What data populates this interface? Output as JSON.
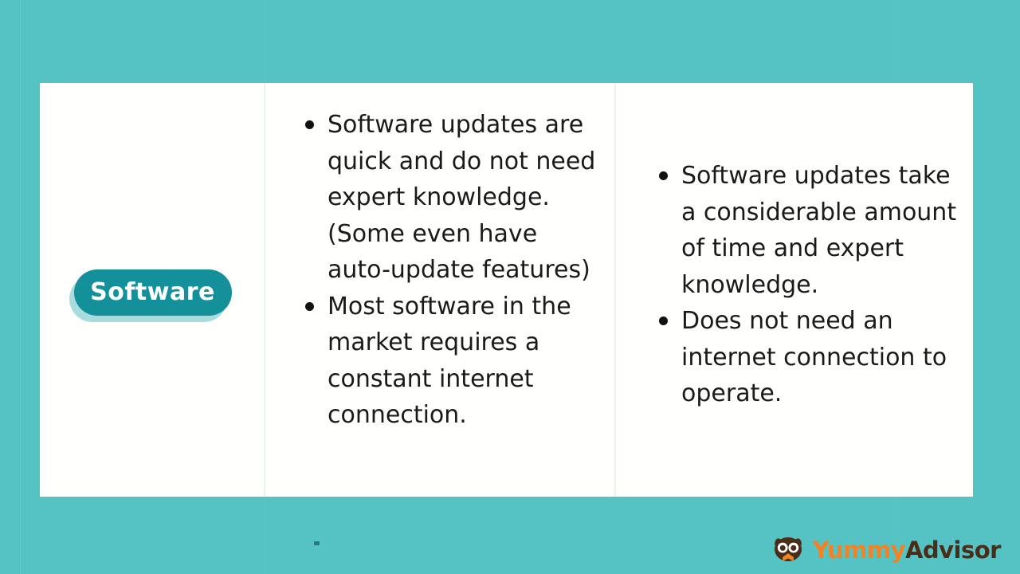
{
  "slide": {
    "background_color": "#55c3c4",
    "card_background": "#fffffd",
    "accent_color": "#14909a",
    "divider_color": "#e8f3f3",
    "text_color": "#1a1a1a"
  },
  "label_column": {
    "pill_label": "Software",
    "pill_fill": "#14909a",
    "pill_shadow": "#a9dcdd",
    "pill_text_color": "#ffffff"
  },
  "advantages_column": {
    "bullets": [
      "Software updates are quick and do not need expert knowledge. (Some even have auto-update features)",
      "Most software in the market requires a constant internet connection."
    ]
  },
  "disadvantages_column": {
    "bullets": [
      "Software updates take a considerable amount of time and expert knowledge.",
      "Does not need an internet connection to operate."
    ]
  },
  "watermark": {
    "icon": "owl-icon",
    "text_primary": "Yummy",
    "text_secondary": "Advisor",
    "primary_color": "#f58220",
    "secondary_color": "#4a2d19"
  }
}
